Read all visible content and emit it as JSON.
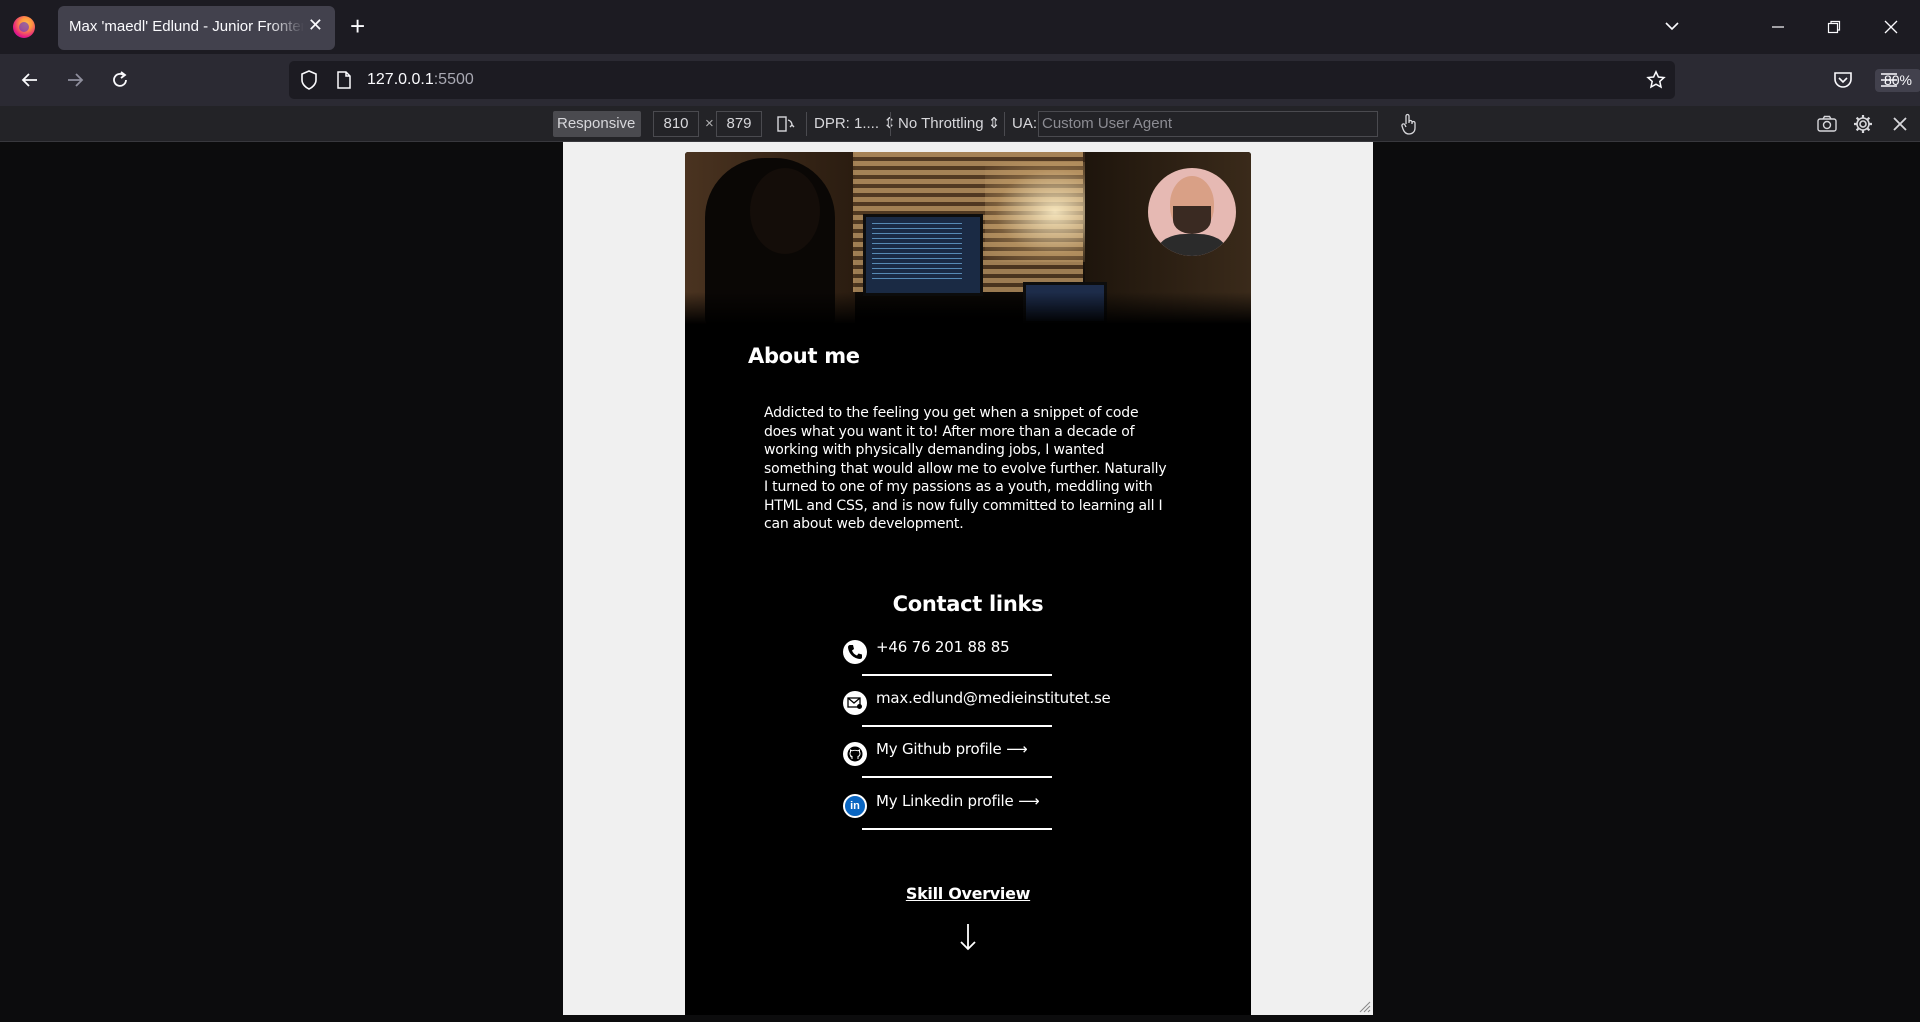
{
  "browser": {
    "tab_title": "Max 'maedl' Edlund - Junior Frontend Developer",
    "new_tab_symbol": "+",
    "url_host": "127.0.0.1",
    "url_port": ":5500",
    "zoom": "80%"
  },
  "rdm_toolbar": {
    "device_mode": "Responsive",
    "width": "810",
    "height": "879",
    "times": "×",
    "dpr": "DPR: 1....",
    "throttling": "No Throttling",
    "ua_label": "UA:",
    "ua_placeholder": "Custom User Agent"
  },
  "page": {
    "about_title": "About me",
    "about_text": "Addicted to the feeling you get when a snippet of code does what you want it to! After more than a decade of working with physically demanding jobs, I wanted something that would allow me to evolve further. Naturally I turned to one of my passions as a youth, meddling with HTML and CSS, and is now fully committed to learning all I can about web development.",
    "contact_title": "Contact links",
    "contacts": [
      {
        "icon": "phone-icon",
        "text": "+46 76 201 88 85"
      },
      {
        "icon": "email-icon",
        "text": "max.edlund@medieinstitutet.se"
      },
      {
        "icon": "github-icon",
        "text": "My Github profile ⟶"
      },
      {
        "icon": "linkedin-icon",
        "text": "My Linkedin profile ⟶"
      }
    ],
    "skill_link": "Skill Overview"
  },
  "colors": {
    "browser_bg": "#1c1b22",
    "toolbar_bg": "#2b2a33",
    "page_bg": "#000000",
    "linkedin_blue": "#0a66c2"
  }
}
